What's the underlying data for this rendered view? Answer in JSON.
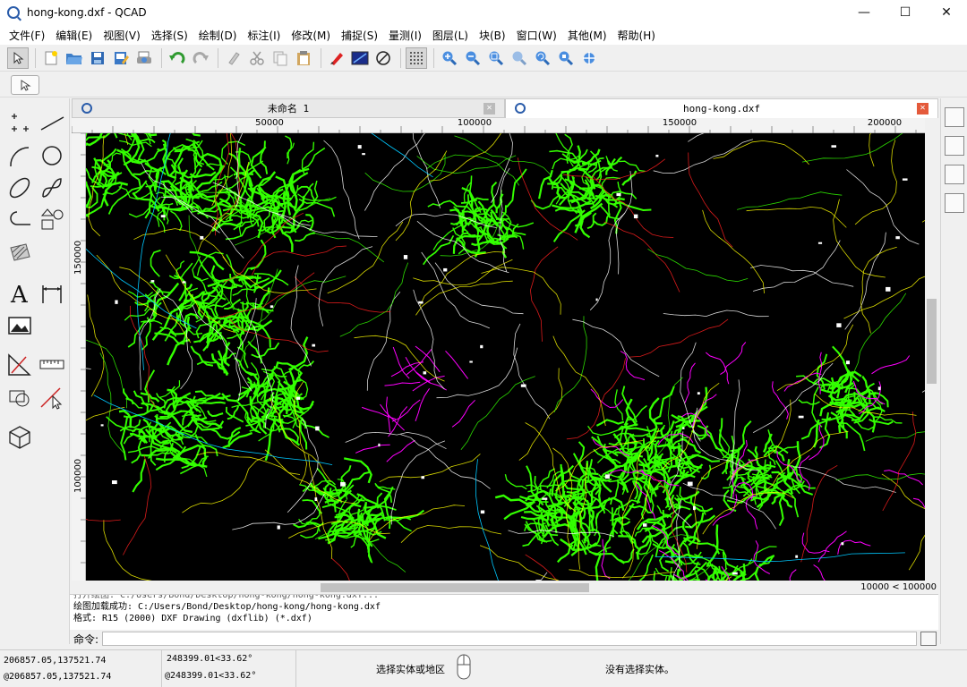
{
  "window": {
    "title": "hong-kong.dxf - QCAD",
    "minimize": "—",
    "maximize": "☐",
    "close": "✕"
  },
  "menu": [
    "文件(F)",
    "编辑(E)",
    "视图(V)",
    "选择(S)",
    "绘制(D)",
    "标注(I)",
    "修改(M)",
    "捕捉(S)",
    "量测(I)",
    "图层(L)",
    "块(B)",
    "窗口(W)",
    "其他(M)",
    "帮助(H)"
  ],
  "tabs": [
    {
      "label": "未命名 1",
      "close": "✕",
      "active": false
    },
    {
      "label": "hong-kong.dxf",
      "close": "✕",
      "active": true
    }
  ],
  "ruler": {
    "horizontal": [
      "50000",
      "100000",
      "150000",
      "200000"
    ],
    "vertical": [
      "150000",
      "100000"
    ]
  },
  "scale_info": "10000 < 100000",
  "console": {
    "lines": [
      "打开绘图:  C:/Users/Bond/Desktop/hong-kong/hong-kong.dxf...",
      "绘图加载成功:  C:/Users/Bond/Desktop/hong-kong/hong-kong.dxf",
      "格式:  R15 (2000) DXF Drawing (dxflib) (*.dxf)"
    ]
  },
  "command": {
    "label": "命令:"
  },
  "status": {
    "abs_coord": "206857.05,137521.74",
    "rel_coord": "@206857.05,137521.74",
    "polar": "248399.01<33.62°",
    "rel_polar": "@248399.01<33.62°",
    "hint": "选择实体或地区",
    "selection": "没有选择实体。"
  },
  "colors": {
    "canvas_bg": "#000000",
    "urban": "#33ff00",
    "road_white": "#ffffff",
    "road_yellow": "#ffff00",
    "road_red": "#ff2020",
    "boundary_magenta": "#ff00ff",
    "water_cyan": "#00c8ff"
  }
}
